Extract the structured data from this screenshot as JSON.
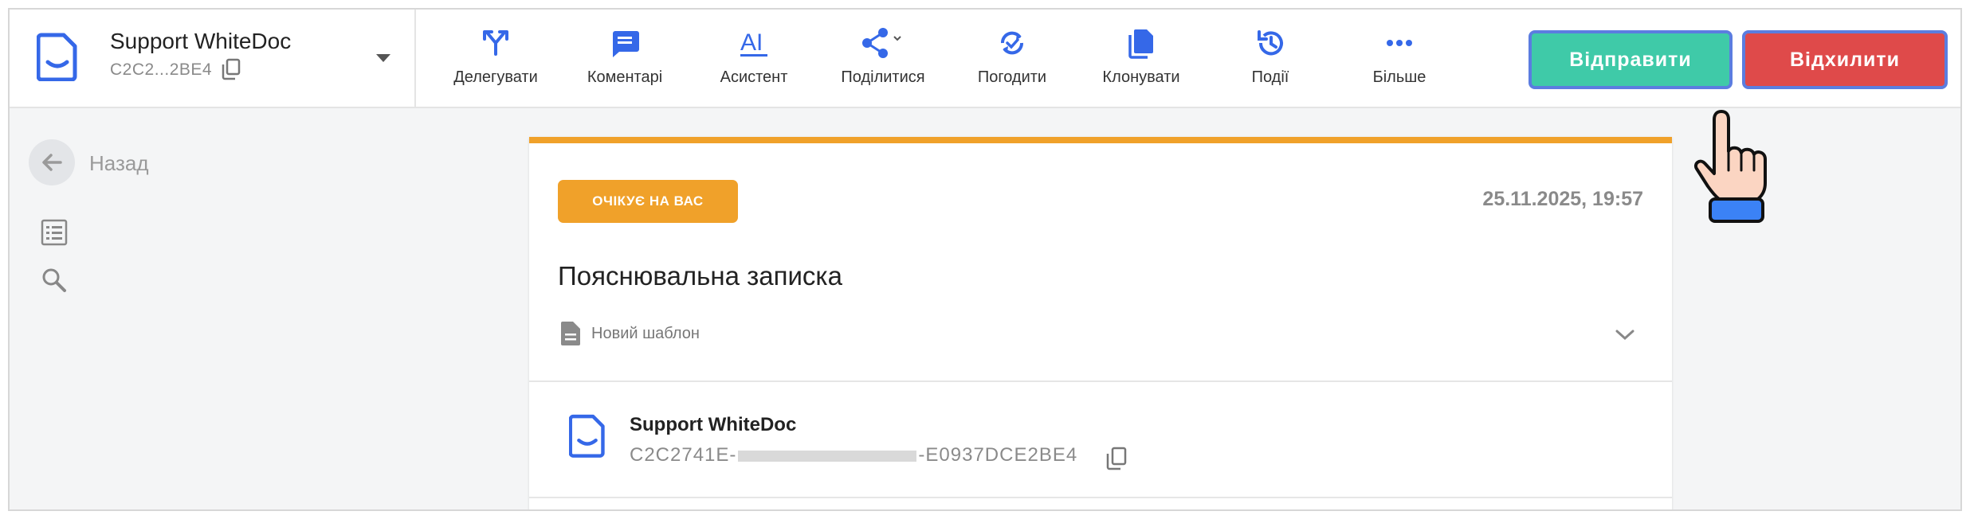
{
  "doc": {
    "name": "Support WhiteDoc",
    "short_id": "C2C2...2BE4"
  },
  "toolbar": {
    "items": [
      {
        "label": "Делегувати",
        "icon": "delegate-icon"
      },
      {
        "label": "Коментарі",
        "icon": "comment-icon"
      },
      {
        "label": "Асистент",
        "icon": "assistant-icon"
      },
      {
        "label": "Поділитися",
        "icon": "share-icon"
      },
      {
        "label": "Погодити",
        "icon": "approve-icon"
      },
      {
        "label": "Клонувати",
        "icon": "clone-icon"
      },
      {
        "label": "Події",
        "icon": "history-icon"
      },
      {
        "label": "Більше",
        "icon": "more-icon"
      }
    ]
  },
  "actions": {
    "send_label": "Відправити",
    "reject_label": "Відхилити"
  },
  "sidebar": {
    "back_label": "Назад"
  },
  "card": {
    "status_badge": "ОЧІКУЄ НА ВАС",
    "date": "25.11.2025, 19:57",
    "title": "Пояснювальна записка",
    "template": "Новий шаблон",
    "sender_name": "Support WhiteDoc",
    "sender_id_prefix": "C2C2741E-",
    "sender_id_suffix": "-E0937DCE2BE4"
  },
  "colors": {
    "accent_orange": "#f0a12a",
    "send_green": "#3fcaa8",
    "reject_red": "#df4a4a",
    "brand_blue": "#3568e8",
    "button_focus_border": "#5b7de0"
  }
}
